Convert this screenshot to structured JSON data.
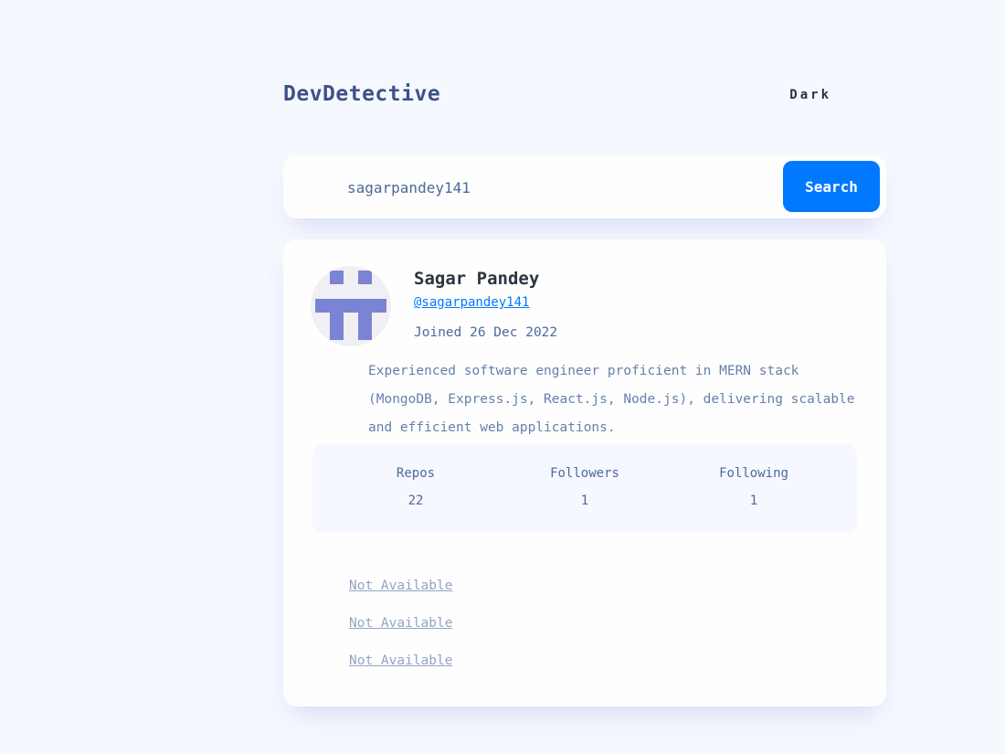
{
  "header": {
    "title": "DevDetective",
    "theme_toggle_label": "Dark"
  },
  "search": {
    "value": "sagarpandey141",
    "button_label": "Search"
  },
  "profile": {
    "name": "Sagar Pandey",
    "username": "@sagarpandey141",
    "joined": "Joined 26 Dec 2022",
    "bio": "Experienced software engineer proficient in MERN stack (MongoDB, Express.js, React.js, Node.js), delivering scalable and efficient web applications.",
    "stats": [
      {
        "label": "Repos",
        "value": "22"
      },
      {
        "label": "Followers",
        "value": "1"
      },
      {
        "label": "Following",
        "value": "1"
      }
    ],
    "links": [
      "Not Available",
      "Not Available",
      "Not Available"
    ]
  },
  "colors": {
    "accent": "#0079ff",
    "background": "#f6f8ff",
    "card": "#fefefe",
    "text": "#4b6a9b",
    "heading": "#2b3442",
    "avatar_identicon": "#7b83d4"
  }
}
